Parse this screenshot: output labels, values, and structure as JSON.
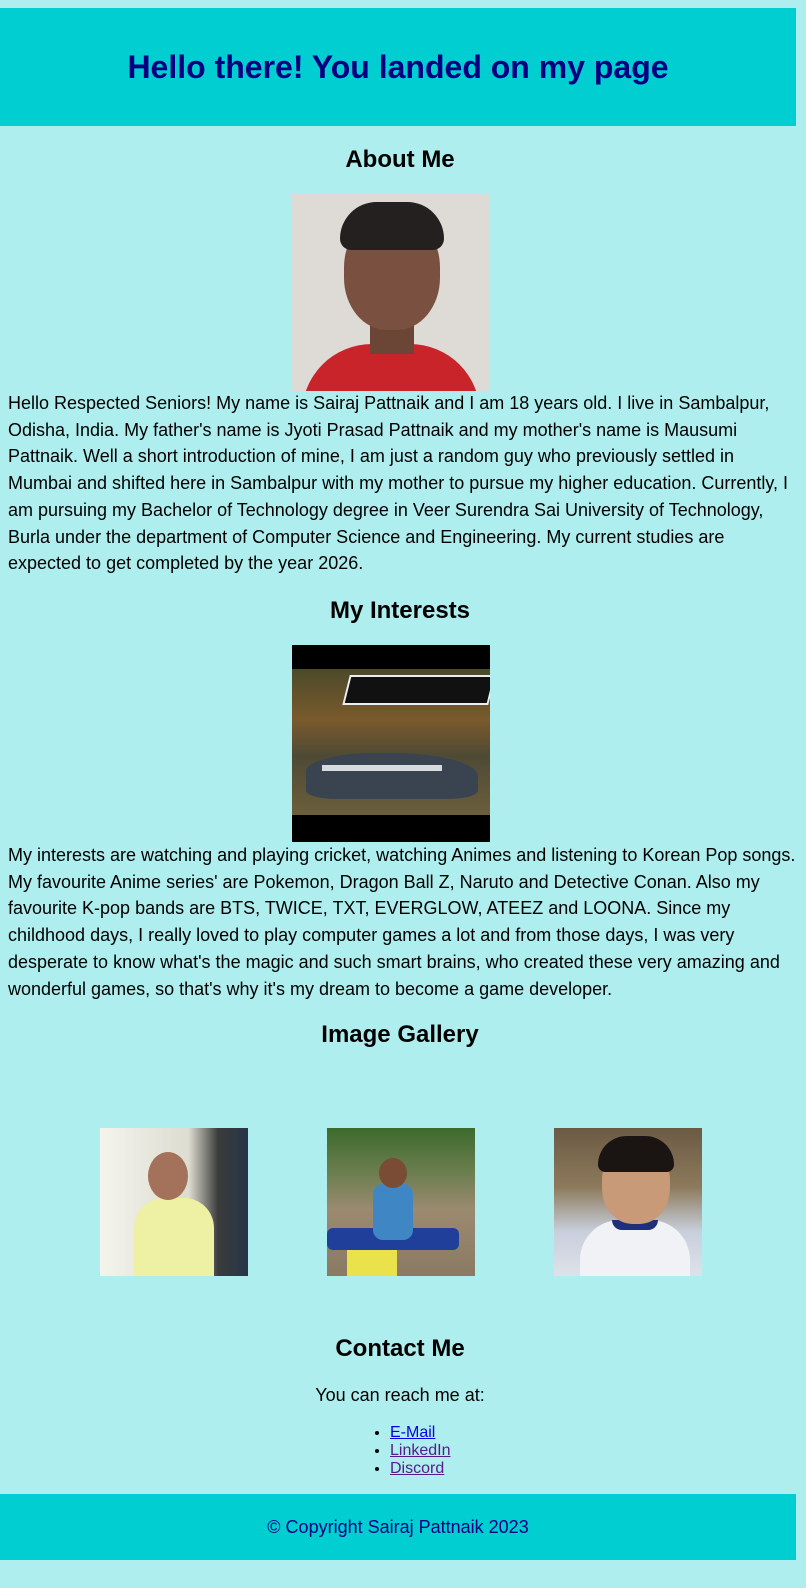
{
  "header": {
    "title": "Hello there! You landed on my page"
  },
  "about": {
    "heading": "About Me",
    "text": "Hello Respected Seniors! My name is Sairaj Pattnaik and I am 18 years old. I live in Sambalpur, Odisha, India. My father's name is Jyoti Prasad Pattnaik and my mother's name is Mausumi Pattnaik. Well a short introduction of mine, I am just a random guy who previously settled in Mumbai and shifted here in Sambalpur with my mother to pursue my higher education. Currently, I am pursuing my Bachelor of Technology degree in Veer Surendra Sai University of Technology, Burla under the department of Computer Science and Engineering. My current studies are expected to get completed by the year 2026."
  },
  "interests": {
    "heading": "My Interests",
    "text": "My interests are watching and playing cricket, watching Animes and listening to Korean Pop songs. My favourite Anime series' are Pokemon, Dragon Ball Z, Naruto and Detective Conan. Also my favourite K-pop bands are BTS, TWICE, TXT, EVERGLOW, ATEEZ and LOONA. Since my childhood days, I really loved to play computer games a lot and from those days, I was very desperate to know what's the magic and such smart brains, who created these very amazing and wonderful games, so that's why it's my dream to become a game developer."
  },
  "gallery": {
    "heading": "Image Gallery"
  },
  "contact": {
    "heading": "Contact Me",
    "intro": "You can reach me at:",
    "links": [
      "E-Mail",
      "LinkedIn",
      "Discord"
    ]
  },
  "footer": {
    "copyright": "© Copyright Sairaj Pattnaik 2023"
  },
  "colors": {
    "page_background": "#afeeee",
    "banner_background": "#00ced1",
    "banner_text": "#000080",
    "link": "#0000ee",
    "visited_link": "#551a8b"
  }
}
